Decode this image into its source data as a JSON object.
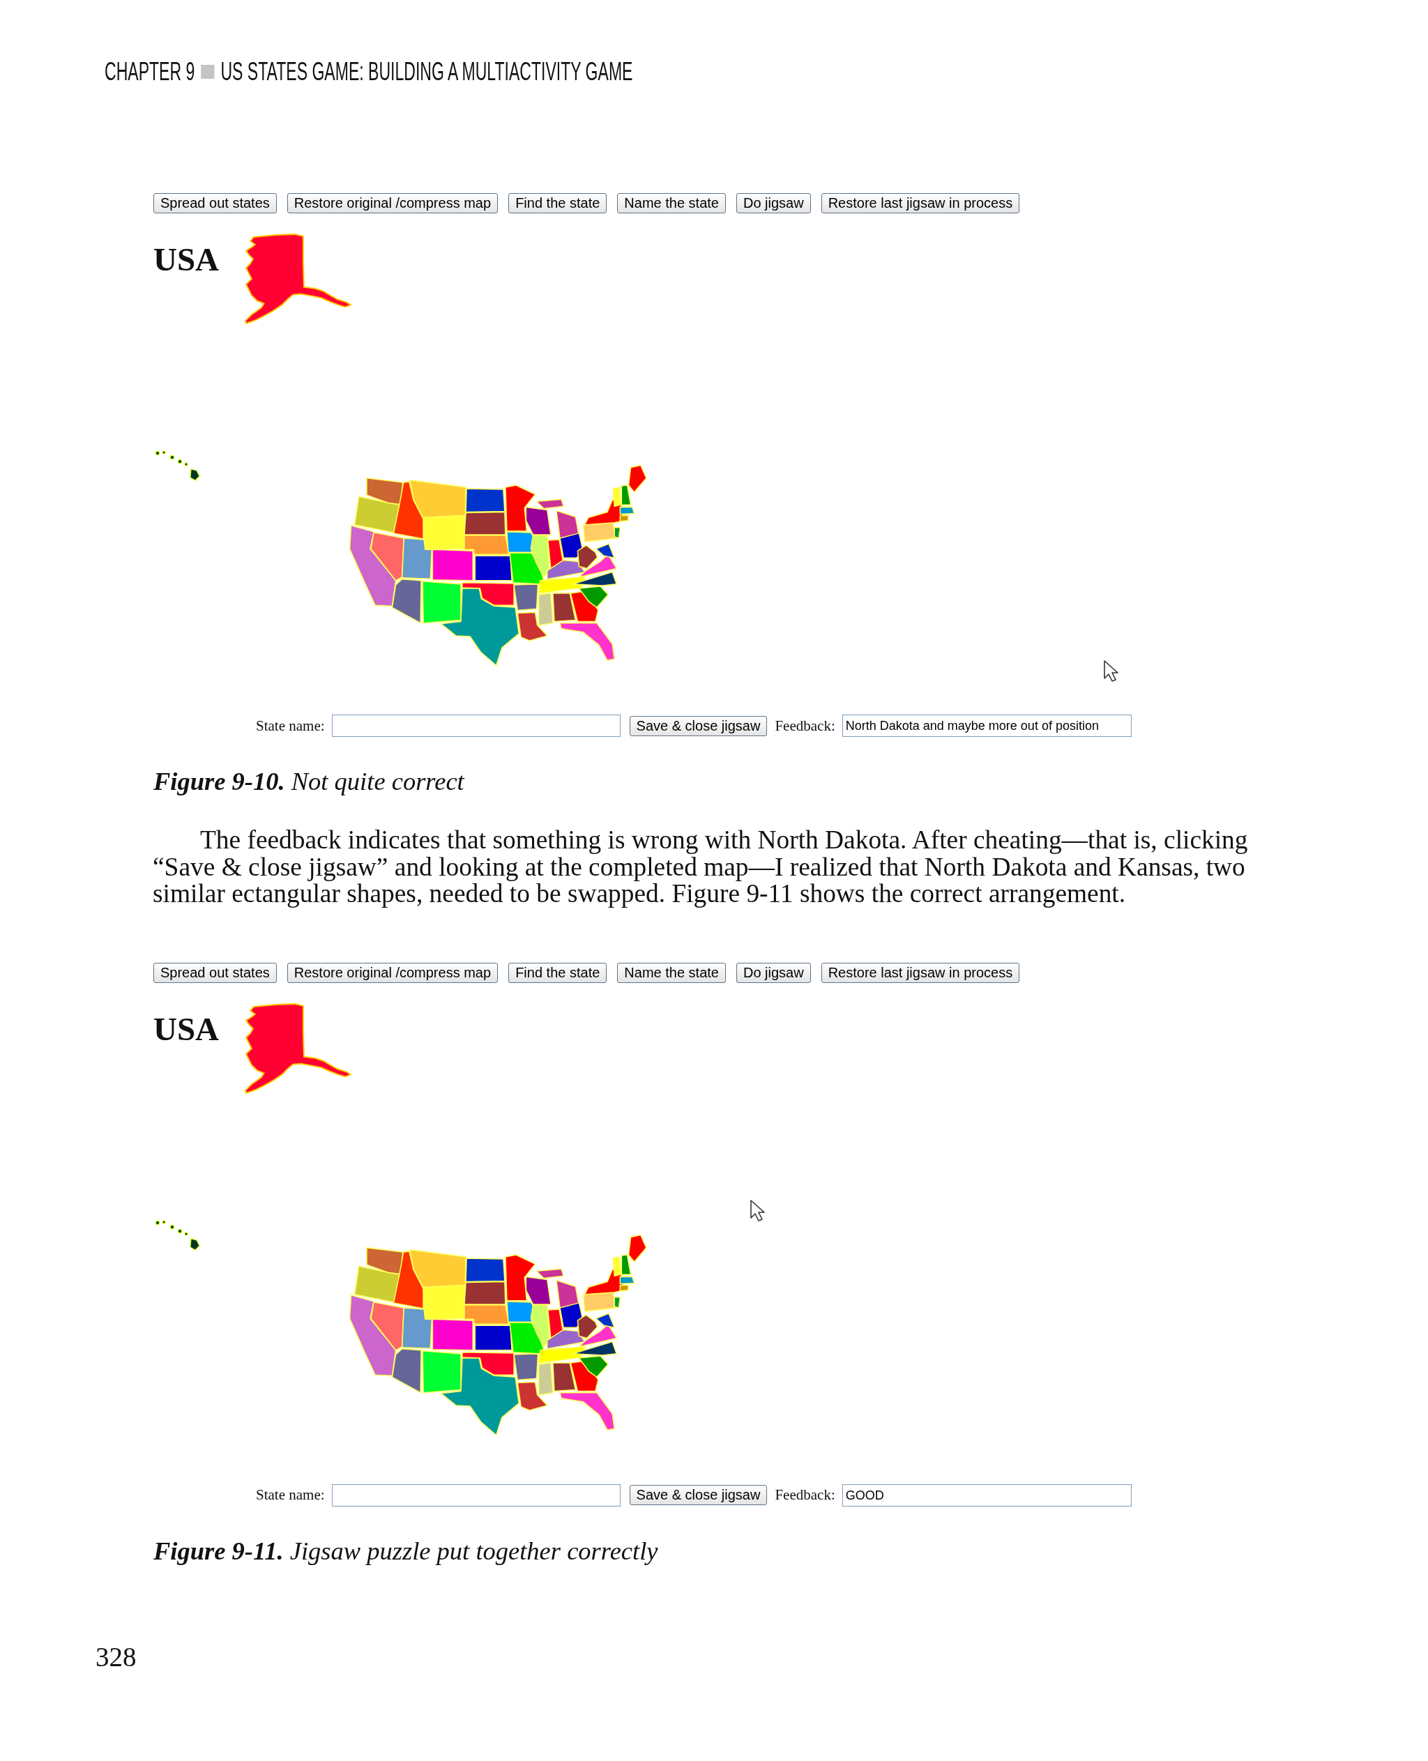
{
  "running_head": {
    "chapter": "CHAPTER 9",
    "title": "US STATES GAME: BUILDING A MULTIACTIVITY GAME"
  },
  "blocks": [
    {
      "kind": "figure",
      "buttons": [
        "Spread out states",
        "Restore original /compress map",
        "Find the state",
        "Name the state",
        "Do jigsaw",
        "Restore last jigsaw in process"
      ],
      "heading": "USA",
      "state_name": {
        "label": "State name:"
      },
      "save_button": "Save & close jigsaw",
      "feedback": {
        "label": "Feedback:",
        "value": "North Dakota and maybe more out of position"
      },
      "caption": "**Figure 9-10.** Not quite correct"
    },
    {
      "kind": "paragraph",
      "text": "The feedback indicates that something is wrong with North Dakota. After cheating—that is, clicking “Save & close jigsaw” and looking at the completed map—I realized that North Dakota and Kansas, two similar ectangular shapes, needed to be swapped. Figure 9-11 shows the correct arrangement."
    },
    {
      "kind": "figure",
      "buttons": [
        "Spread out states",
        "Restore original /compress map",
        "Find the state",
        "Name the state",
        "Do jigsaw",
        "Restore last jigsaw in process"
      ],
      "heading": "USA",
      "state_name": {
        "label": "State name:"
      },
      "save_button": "Save & close jigsaw",
      "feedback": {
        "label": "Feedback:",
        "value": "GOOD"
      },
      "caption": "**Figure 9-11.** Jigsaw puzzle put together correctly"
    }
  ],
  "page_number": "328"
}
